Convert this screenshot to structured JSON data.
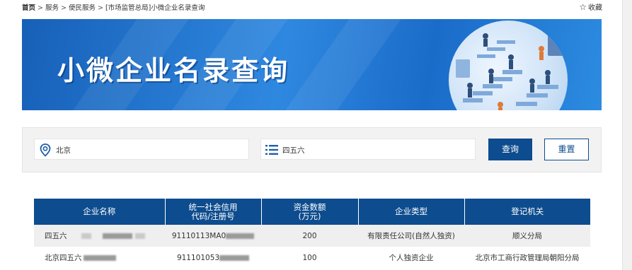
{
  "breadcrumb": {
    "home": "首页",
    "items": [
      "服务",
      "便民服务",
      "[市场监管总局]小微企业名录查询"
    ],
    "separator": ">"
  },
  "favorite": {
    "icon": "star-outline-icon",
    "label": "收藏"
  },
  "banner": {
    "title": "小微企业名录查询"
  },
  "search": {
    "location": {
      "icon": "location-pin-icon",
      "value": "北京"
    },
    "name": {
      "icon": "list-icon",
      "value": "四五六"
    },
    "query_label": "查询",
    "reset_label": "重置"
  },
  "table": {
    "headers": [
      "企业名称",
      "统一社会信用\n代码/注册号",
      "资金数额\n(万元)",
      "企业类型",
      "登记机关"
    ],
    "rows": [
      {
        "name": "四五六",
        "code": "91110113MA0",
        "capital": "200",
        "type": "有限责任公司(自然人独资)",
        "authority": "顺义分局"
      },
      {
        "name": "北京四五六",
        "code": "911101053",
        "capital": "100",
        "type": "个人独资企业",
        "authority": "北京市工商行政管理局朝阳分局"
      }
    ]
  },
  "colors": {
    "header_bg": "#0d4c8e",
    "accent": "#0d4c8e",
    "banner_blue": "#1f74d0"
  }
}
